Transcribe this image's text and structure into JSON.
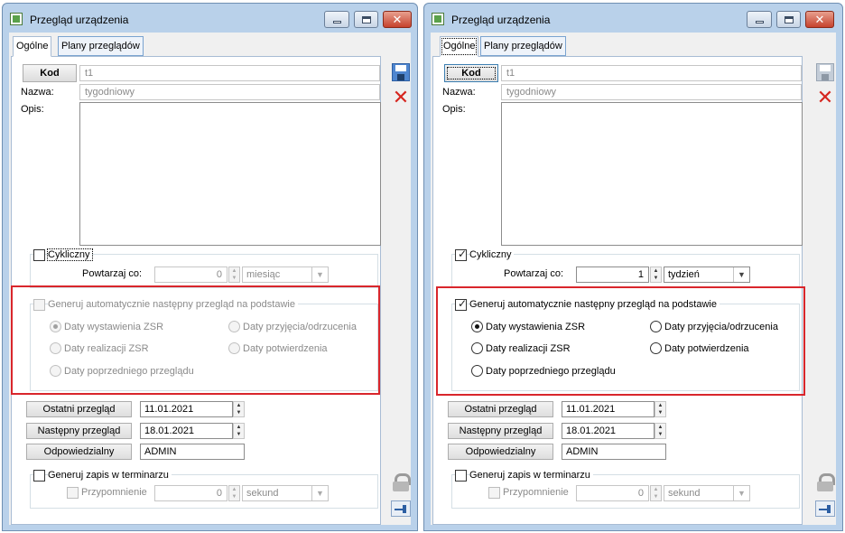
{
  "windows": [
    {
      "title": "Przegląd urządzenia",
      "tabs": [
        "Ogólne",
        "Plany przeglądów"
      ],
      "kod_label": "Kod",
      "kod_value": "t1",
      "nazwa_label": "Nazwa:",
      "nazwa_value": "tygodniowy",
      "opis_label": "Opis:",
      "cykliczny_label": "Cykliczny",
      "cykliczny_checked": false,
      "powtarzaj_label": "Powtarzaj co:",
      "powtarzaj_value": "0",
      "powtarzaj_unit": "miesiąc",
      "generuj_label": "Generuj automatycznie następny przegląd na podstawie",
      "generuj_checked": false,
      "radio_options": [
        "Daty wystawienia ZSR",
        "Daty przyjęcia/odrzucenia",
        "Daty realizacji ZSR",
        "Daty potwierdzenia",
        "Daty poprzedniego przeglądu"
      ],
      "radio_selected": "Daty wystawienia ZSR",
      "ostatni_label": "Ostatni przegląd",
      "ostatni_value": "11.01.2021",
      "nastepny_label": "Następny przegląd",
      "nastepny_value": "18.01.2021",
      "odpowiedzialny_label": "Odpowiedzialny",
      "odpowiedzialny_value": "ADMIN",
      "zapis_label": "Generuj zapis w terminarzu",
      "przypomnienie_label": "Przypomnienie",
      "przypomnienie_value": "0",
      "przypomnienie_unit": "sekund"
    },
    {
      "title": "Przegląd urządzenia",
      "tabs": [
        "Ogólne",
        "Plany przeglądów"
      ],
      "kod_label": "Kod",
      "kod_value": "t1",
      "nazwa_label": "Nazwa:",
      "nazwa_value": "tygodniowy",
      "opis_label": "Opis:",
      "cykliczny_label": "Cykliczny",
      "cykliczny_checked": true,
      "powtarzaj_label": "Powtarzaj co:",
      "powtarzaj_value": "1",
      "powtarzaj_unit": "tydzień",
      "generuj_label": "Generuj automatycznie następny przegląd na podstawie",
      "generuj_checked": true,
      "radio_options": [
        "Daty wystawienia ZSR",
        "Daty przyjęcia/odrzucenia",
        "Daty realizacji ZSR",
        "Daty potwierdzenia",
        "Daty poprzedniego przeglądu"
      ],
      "radio_selected": "Daty wystawienia ZSR",
      "ostatni_label": "Ostatni przegląd",
      "ostatni_value": "11.01.2021",
      "nastepny_label": "Następny przegląd",
      "nastepny_value": "18.01.2021",
      "odpowiedzialny_label": "Odpowiedzialny",
      "odpowiedzialny_value": "ADMIN",
      "zapis_label": "Generuj zapis w terminarzu",
      "przypomnienie_label": "Przypomnienie",
      "przypomnienie_value": "0",
      "przypomnienie_unit": "sekund"
    }
  ],
  "colors": {
    "highlight": "#d9262c",
    "window_frame": "#b9d1ea",
    "close_button": "#c6422d",
    "save_icon": "#4f86cf",
    "delete_icon": "#d6261f"
  },
  "icons": [
    "app-icon",
    "minimize-icon",
    "maximize-icon",
    "close-icon",
    "save-icon",
    "delete-icon",
    "lock-icon",
    "pin-icon",
    "dropdown-arrow-icon",
    "spinner-arrows-icon"
  ]
}
